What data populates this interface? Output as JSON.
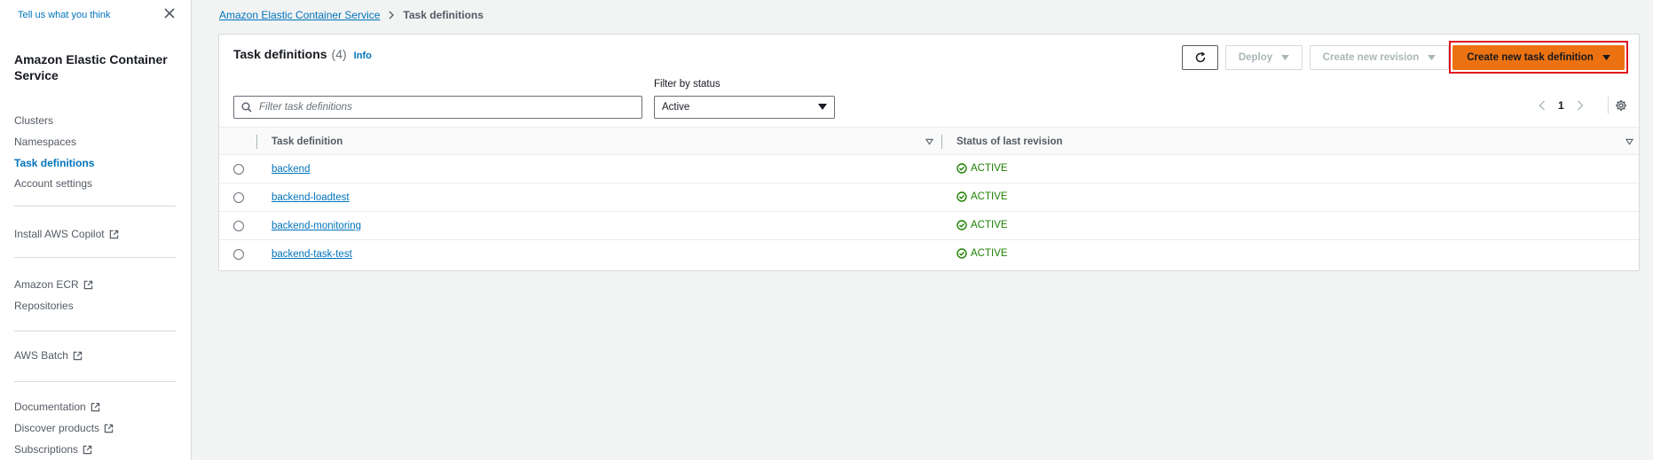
{
  "sidebar": {
    "feedback": "Tell us what you think",
    "title": "Amazon Elastic Container Service",
    "nav": [
      "Clusters",
      "Namespaces",
      "Task definitions",
      "Account settings"
    ],
    "copilot": "Install AWS Copilot",
    "ecr": "Amazon ECR",
    "repositories": "Repositories",
    "batch": "AWS Batch",
    "documentation": "Documentation",
    "discover": "Discover products",
    "subscriptions": "Subscriptions"
  },
  "breadcrumb": {
    "parent": "Amazon Elastic Container Service",
    "current": "Task definitions"
  },
  "panel": {
    "title": "Task definitions",
    "count": "(4)",
    "info": "Info",
    "deploy": "Deploy",
    "create_revision": "Create new revision",
    "create_task": "Create new task definition",
    "filter_label": "Filter by status",
    "search_placeholder": "Filter task definitions",
    "status_value": "Active",
    "page": "1"
  },
  "table": {
    "col_task": "Task definition",
    "col_status": "Status of last revision",
    "rows": [
      {
        "name": "backend",
        "status": "ACTIVE"
      },
      {
        "name": "backend-loadtest",
        "status": "ACTIVE"
      },
      {
        "name": "backend-monitoring",
        "status": "ACTIVE"
      },
      {
        "name": "backend-task-test",
        "status": "ACTIVE"
      }
    ]
  },
  "colors": {
    "link": "#0073bb",
    "primary": "#ec7211",
    "success": "#1d8102",
    "highlight": "#e0121f"
  }
}
